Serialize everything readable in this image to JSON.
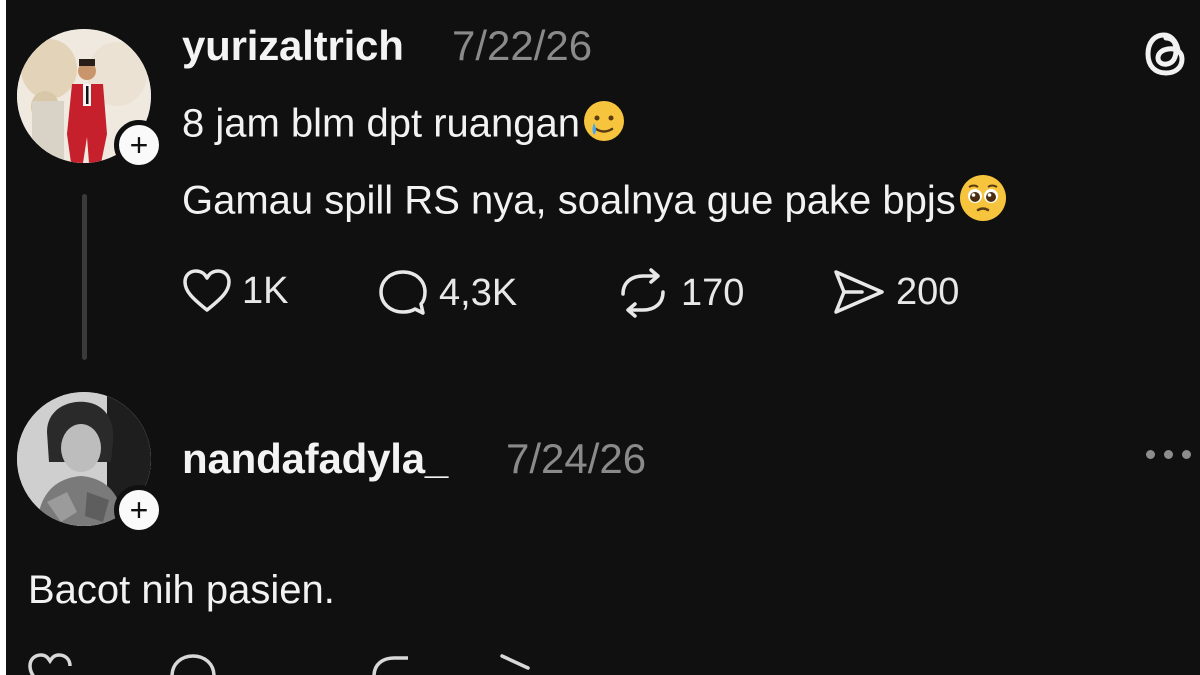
{
  "app": {
    "brand": "Threads",
    "accent": "#101010",
    "text_color": "#f2f2f2",
    "muted_color": "#8a8a8a"
  },
  "posts": [
    {
      "username": "yurizaltrich",
      "date": "7/22/26",
      "lines": [
        "8 jam blm dpt ruangan",
        "Gamau spill RS nya, soalnya gue pake bpjs"
      ],
      "emojis": [
        "face-holding-back-tears-smile",
        "pleading-face"
      ],
      "actions": {
        "likes": "1K",
        "replies": "4,3K",
        "reposts": "170",
        "shares": "200"
      }
    },
    {
      "username": "nandafadyla_",
      "date": "7/24/26",
      "text": "Bacot nih pasien."
    }
  ],
  "icons": [
    "threads-logo-icon",
    "plus-icon",
    "heart-icon",
    "comment-icon",
    "repost-icon",
    "share-icon",
    "more-icon"
  ]
}
